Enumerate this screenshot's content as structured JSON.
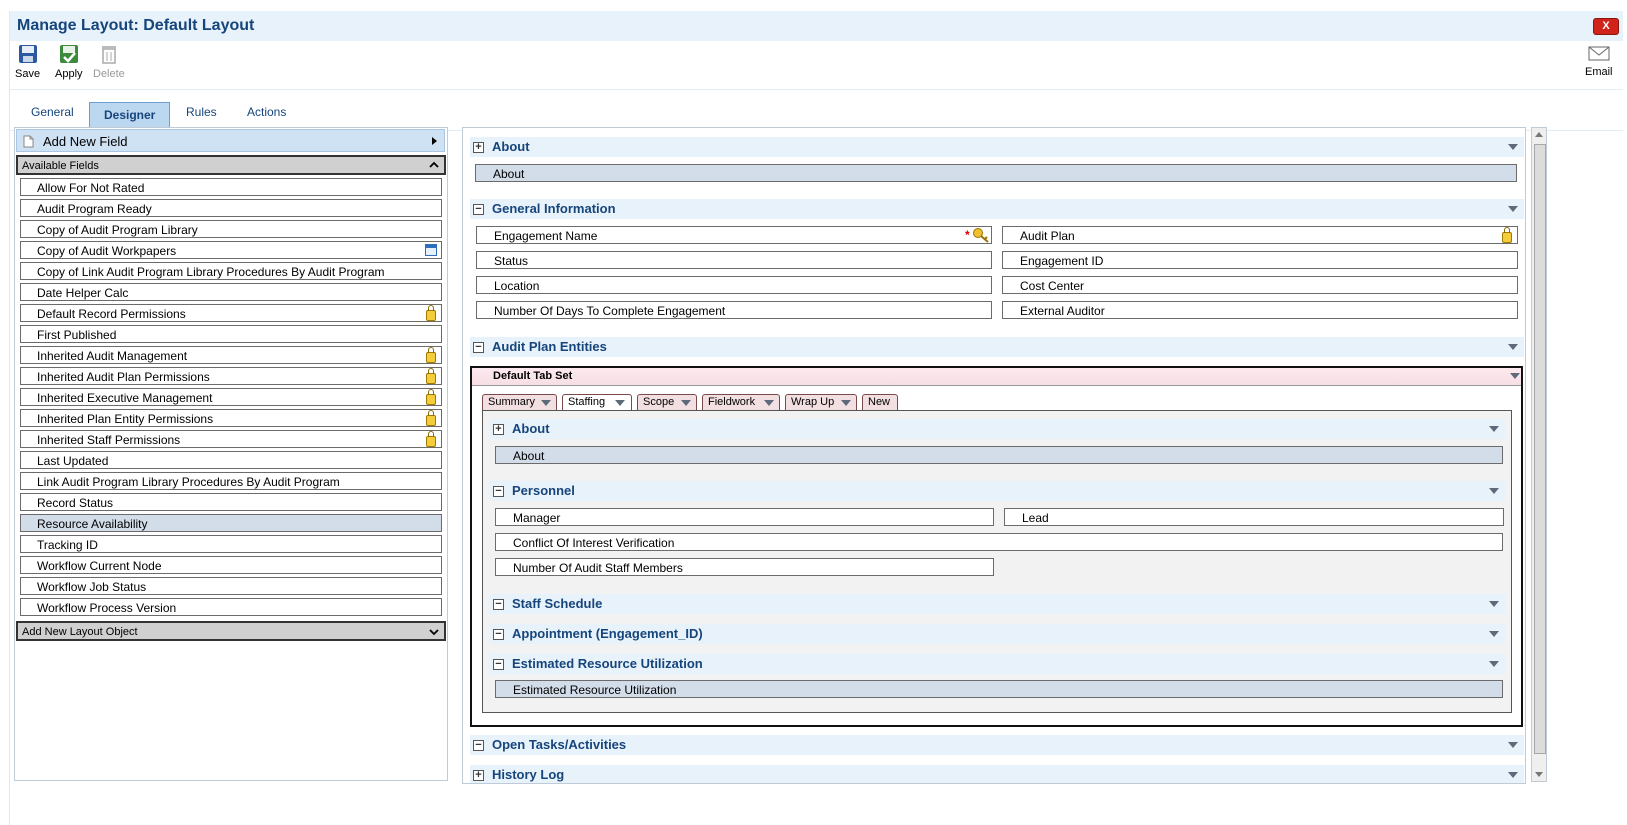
{
  "window": {
    "title": "Manage Layout: Default Layout",
    "close_label": "X"
  },
  "toolbar": {
    "save": "Save",
    "apply": "Apply",
    "delete": "Delete",
    "email": "Email"
  },
  "tabs": [
    {
      "label": "General"
    },
    {
      "label": "Designer"
    },
    {
      "label": "Rules"
    },
    {
      "label": "Actions"
    }
  ],
  "left": {
    "add_new_field": "Add New Field",
    "available_fields": "Available Fields",
    "fields": [
      {
        "label": "Allow For Not Rated",
        "icon": ""
      },
      {
        "label": "Audit Program Ready",
        "icon": ""
      },
      {
        "label": "Copy of Audit Program Library",
        "icon": ""
      },
      {
        "label": "Copy of Audit Workpapers",
        "icon": "calendar-icon"
      },
      {
        "label": "Copy of Link Audit Program Library Procedures By Audit Program",
        "icon": ""
      },
      {
        "label": "Date Helper Calc",
        "icon": ""
      },
      {
        "label": "Default Record Permissions",
        "icon": "lock-icon"
      },
      {
        "label": "First Published",
        "icon": ""
      },
      {
        "label": "Inherited Audit Management",
        "icon": "lock-icon"
      },
      {
        "label": "Inherited Audit Plan Permissions",
        "icon": "lock-icon"
      },
      {
        "label": "Inherited Executive Management",
        "icon": "lock-icon"
      },
      {
        "label": "Inherited Plan Entity Permissions",
        "icon": "lock-icon"
      },
      {
        "label": "Inherited Staff Permissions",
        "icon": "lock-icon"
      },
      {
        "label": "Last Updated",
        "icon": ""
      },
      {
        "label": "Link Audit Program Library Procedures By Audit Program",
        "icon": ""
      },
      {
        "label": "Record Status",
        "icon": ""
      },
      {
        "label": "Resource Availability",
        "icon": "",
        "selected": true
      },
      {
        "label": "Tracking ID",
        "icon": ""
      },
      {
        "label": "Workflow Current Node",
        "icon": ""
      },
      {
        "label": "Workflow Job Status",
        "icon": ""
      },
      {
        "label": "Workflow Process Version",
        "icon": ""
      }
    ],
    "add_layout_object": "Add New Layout Object"
  },
  "right": {
    "about_section": {
      "title": "About",
      "field": "About"
    },
    "general_info": {
      "title": "General Information",
      "fields": {
        "engagement_name": "Engagement Name",
        "audit_plan": "Audit Plan",
        "status": "Status",
        "engagement_id": "Engagement ID",
        "location": "Location",
        "cost_center": "Cost Center",
        "days_to_complete": "Number Of Days To Complete Engagement",
        "external_auditor": "External Auditor"
      },
      "required_mark": "*"
    },
    "audit_plan_entities": {
      "title": "Audit Plan Entities"
    },
    "tab_set": {
      "title": "Default Tab Set",
      "tabs": [
        "Summary",
        "Staffing",
        "Scope",
        "Fieldwork",
        "Wrap Up",
        "New"
      ],
      "about": {
        "title": "About",
        "field": "About"
      },
      "personnel": {
        "title": "Personnel",
        "manager": "Manager",
        "lead": "Lead",
        "conflict": "Conflict Of Interest Verification",
        "staff_members": "Number Of Audit Staff Members"
      },
      "staff_schedule": "Staff Schedule",
      "appointment": "Appointment (Engagement_ID)",
      "estimated": {
        "title": "Estimated Resource Utilization",
        "field": "Estimated Resource Utilization"
      }
    },
    "open_tasks": "Open Tasks/Activities",
    "history_log": "History Log"
  }
}
